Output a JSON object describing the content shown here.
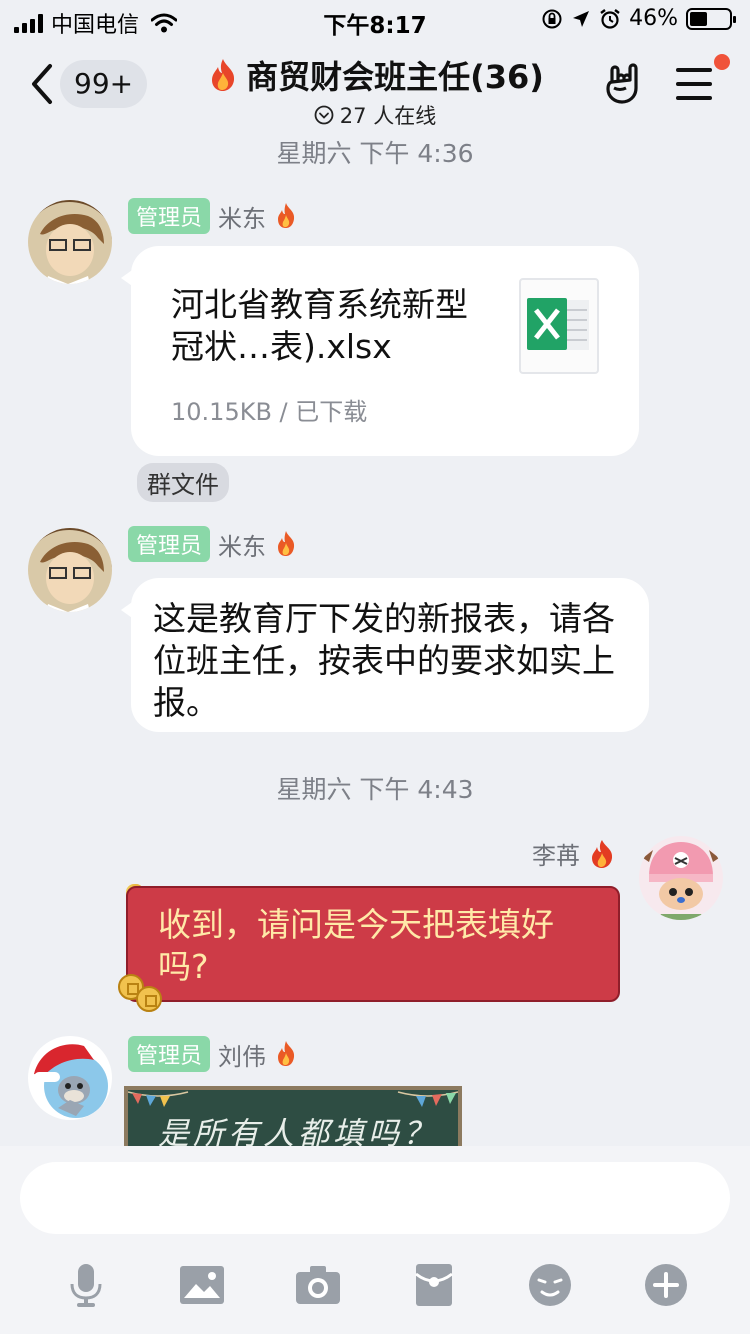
{
  "status_bar": {
    "carrier": "中国电信",
    "time": "下午8:17",
    "battery": "46%",
    "battery_level": 0.46
  },
  "nav": {
    "unread_count": "99+",
    "title": "商贸财会班主任(36)",
    "online": "27 人在线"
  },
  "messages": [
    {
      "type": "time",
      "text": "星期六 下午 4:36"
    },
    {
      "type": "file",
      "role": "管理员",
      "sender": "米东",
      "file_name": "河北省教育系统新型冠状…表).xlsx",
      "file_meta": "10.15KB / 已下载",
      "tag": "群文件"
    },
    {
      "type": "text",
      "role": "管理员",
      "sender": "米东",
      "text": "这是教育厅下发的新报表，请各位班主任，按表中的要求如实上报。"
    },
    {
      "type": "time",
      "text": "星期六 下午 4:43"
    },
    {
      "type": "text",
      "sender": "李苒",
      "text": "收到，请问是今天把表填好吗?"
    },
    {
      "type": "text",
      "role": "管理员",
      "sender": "刘伟",
      "text": "是所有人都填吗？"
    }
  ],
  "input": {
    "value": ""
  },
  "colors": {
    "admin_badge": "#8ad8a8",
    "red_bubble": "#cd3b47",
    "red_bubble_text": "#ffe9a8",
    "notification_dot": "#f0533a"
  },
  "icons": [
    "voice-icon",
    "image-icon",
    "camera-icon",
    "red-packet-icon",
    "emoji-icon",
    "plus-icon"
  ]
}
